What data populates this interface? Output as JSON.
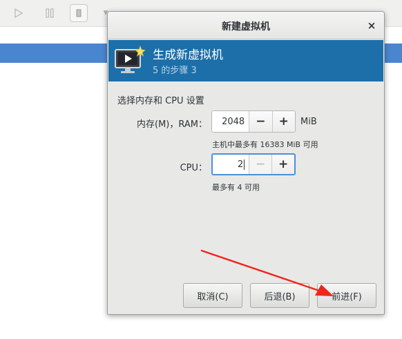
{
  "background": {
    "toolbar": {
      "play_icon": "play-icon",
      "pause_icon": "pause-icon",
      "stop_icon": "stop-icon",
      "dropdown_icon": "chevron-down-icon"
    },
    "selection_color": "#4a86cf"
  },
  "dialog": {
    "title": "新建虚拟机",
    "close_label": "×",
    "header": {
      "title": "生成新虚拟机",
      "subtitle": "5 的步骤 3",
      "icon": "monitor-new-icon",
      "background_color": "#1c6fa8"
    },
    "section_title": "选择内存和  CPU 设置",
    "memory": {
      "label": "内存(M)，RAM：",
      "value": "2048",
      "decrement_label": "−",
      "increment_label": "+",
      "unit": "MiB",
      "hint": "主机中最多有  16383  MiB 可用"
    },
    "cpu": {
      "label": "CPU：",
      "value": "2",
      "decrement_label": "−",
      "increment_label": "+",
      "hint": "最多有  4  可用"
    },
    "buttons": {
      "cancel": "取消(C)",
      "back": "后退(B)",
      "forward": "前进(F)"
    }
  },
  "annotation": {
    "arrow_color": "#f0261d"
  }
}
